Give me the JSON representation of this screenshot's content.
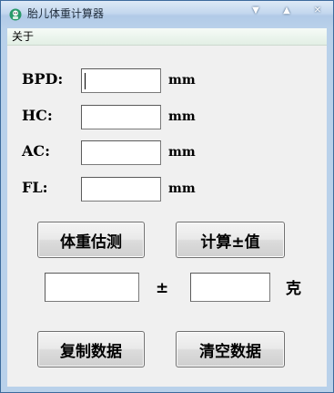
{
  "window": {
    "title": "胎儿体重计算器",
    "icon": "app-logo-icon",
    "controls": [
      "minimize-icon",
      "maximize-icon",
      "close-icon"
    ]
  },
  "menu": {
    "items": [
      {
        "label": "关于"
      }
    ]
  },
  "form": {
    "fields": [
      {
        "label": "BPD:",
        "value": "",
        "unit": "mm"
      },
      {
        "label": "HC:",
        "value": "",
        "unit": "mm"
      },
      {
        "label": "AC:",
        "value": "",
        "unit": "mm"
      },
      {
        "label": "FL:",
        "value": "",
        "unit": "mm"
      }
    ]
  },
  "buttons": {
    "estimate": "体重估测",
    "calc_pm": "计算±值",
    "copy": "复制数据",
    "clear": "清空数据"
  },
  "result": {
    "weight_value": "",
    "pm_symbol": "±",
    "pm_value": "",
    "unit": "克"
  },
  "colors": {
    "titlebar": "#b9d1ea",
    "client_bg": "#f0f0f0",
    "menubar": "#e2efe5"
  }
}
